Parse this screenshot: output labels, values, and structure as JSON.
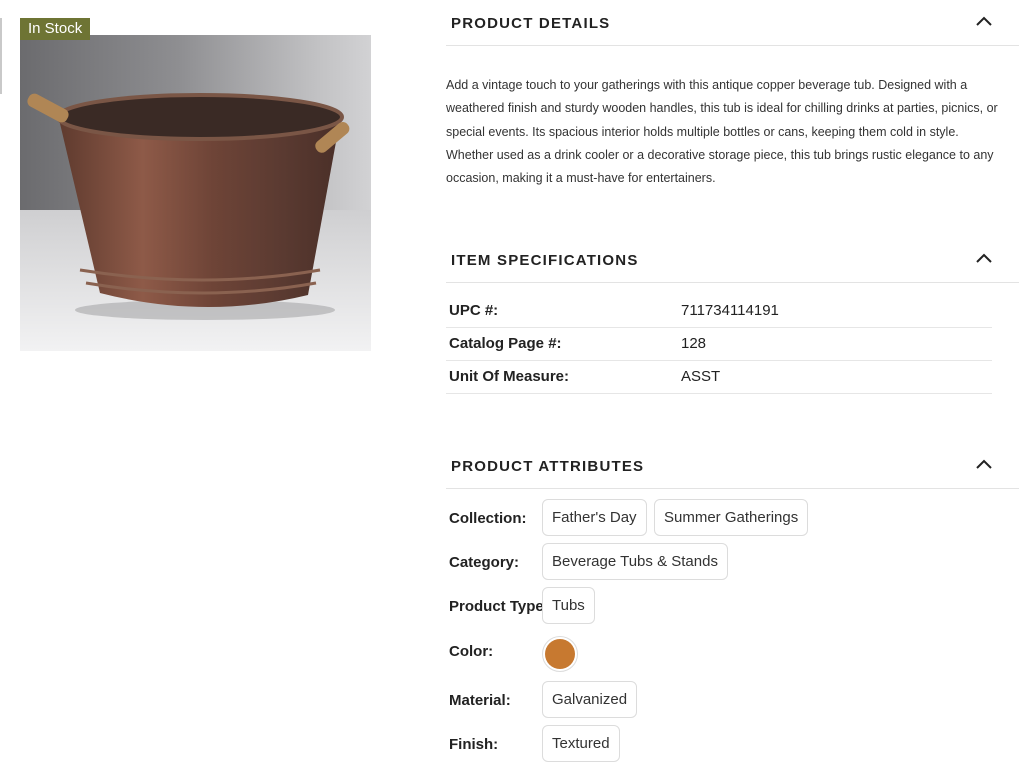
{
  "stock_badge": "In Stock",
  "sections": {
    "product_details": {
      "title": "PRODUCT DETAILS"
    },
    "item_specifications": {
      "title": "ITEM SPECIFICATIONS"
    },
    "product_attributes": {
      "title": "PRODUCT ATTRIBUTES"
    }
  },
  "description": "Add a vintage touch to your gatherings with this antique copper beverage tub. Designed with a weathered finish and sturdy wooden handles, this tub is ideal for chilling drinks at parties, picnics, or special events. Its spacious interior holds multiple bottles or cans, keeping them cold in style. Whether used as a drink cooler or a decorative storage piece, this tub brings rustic elegance to any occasion, making it a must-have for entertainers.",
  "specs": [
    {
      "label": "UPC #:",
      "value": "711734114191"
    },
    {
      "label": "Catalog Page #:",
      "value": "128"
    },
    {
      "label": "Unit Of Measure:",
      "value": "ASST"
    }
  ],
  "attributes": {
    "collection": {
      "label": "Collection:",
      "chips": [
        "Father's Day",
        "Summer Gatherings"
      ]
    },
    "category": {
      "label": "Category:",
      "chips": [
        "Beverage Tubs & Stands"
      ]
    },
    "product_type": {
      "label": "Product Type:",
      "chips": [
        "Tubs"
      ]
    },
    "color": {
      "label": "Color:",
      "swatch": "#c77930"
    },
    "material": {
      "label": "Material:",
      "chips": [
        "Galvanized"
      ]
    },
    "finish": {
      "label": "Finish:",
      "chips": [
        "Textured"
      ]
    }
  },
  "icons": {
    "section_toggle": "chevron-up-icon"
  },
  "colors": {
    "badge": "#6e7434",
    "swatch": "#c77930"
  }
}
